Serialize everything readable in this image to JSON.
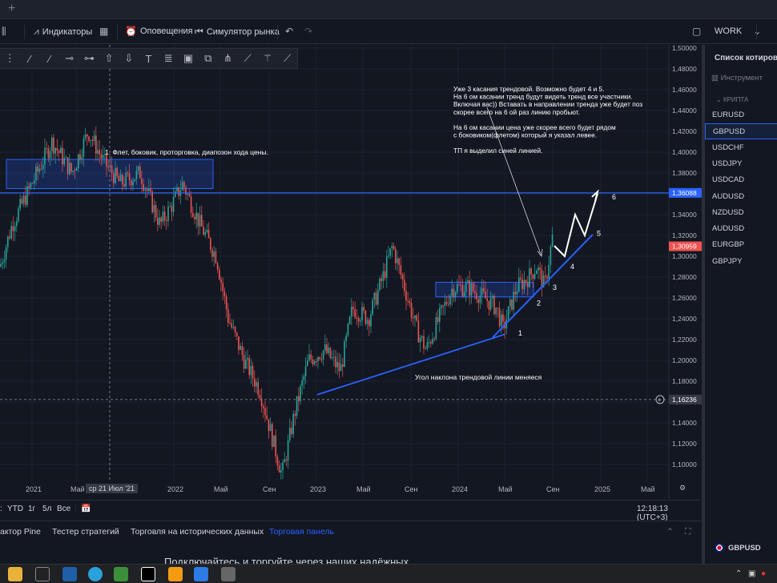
{
  "toolbar": {
    "indicators_label": "Индикаторы",
    "alerts_label": "Оповещения",
    "replay_label": "Симулятор рынка",
    "layout_label": "WORK"
  },
  "chart": {
    "price_axis": [
      "1,50000",
      "1,48000",
      "1,46000",
      "1,44000",
      "1,42000",
      "1,40000",
      "1,38000",
      "1,36000",
      "1,34000",
      "1,32000",
      "1,30000",
      "1,28000",
      "1,26000",
      "1,24000",
      "1,22000",
      "1,20000",
      "1,18000",
      "1,16000",
      "1,14000",
      "1,12000",
      "1,10000"
    ],
    "price_labels": {
      "hline": "1,36088",
      "current": "1,30959",
      "crosshair": "1,16236"
    },
    "time_axis": [
      "2021",
      "Май",
      "2022",
      "Май",
      "Сен",
      "2023",
      "Май",
      "Сен",
      "2024",
      "Май",
      "Сен",
      "2025",
      "Май"
    ],
    "crosshair_date": "ср 21 Июл '21",
    "annotations": {
      "flat": "1. Флет, боковик, проторговка, диапозон хода цены.",
      "note_lines": [
        "Уже 3 касания трендовой. Возможно будет 4 и 5.",
        "На 6 ом касании тренд будут видеть тренд все участники.",
        "Включая вас)) Вставать в направлении тренда уже будет поз",
        "скорее всего на 6 ой раз линию пробьют.",
        "",
        "На 6 ом касании цена уже скорее всего будет рядом",
        "с боковиком(флетом) который я указал левее.",
        "",
        "ТП я выделил синей линией."
      ],
      "slope": "Угол наклона трендовой линии меняеся",
      "touches": [
        "1",
        "2",
        "3",
        "4",
        "5",
        "6"
      ]
    }
  },
  "bottombar": {
    "ranges": [
      "YTD",
      "1г",
      "5л",
      "Все"
    ],
    "clock": "12:18:13 (UTC+3)"
  },
  "panel": {
    "tabs": [
      "актор Pine",
      "Тестер стратегий",
      "Торговля на исторических данных",
      "Торговая панель"
    ],
    "active_tab": "Торговая панель",
    "promo": "Подключайтесь и торгуйте через наших надёжных"
  },
  "sidebar": {
    "title": "Список котировок",
    "column_header": "Инструмент",
    "section": "КРИПТА",
    "symbols": [
      "EURUSD",
      "GBPUSD",
      "USDCHF",
      "USDJPY",
      "USDCAD",
      "AUDUSD",
      "NZDUSD",
      "AUDUSD",
      "EURGBP",
      "GBPJPY"
    ],
    "selected": "GBPUSD",
    "footer_symbol": "GBPUSD"
  },
  "colors": {
    "accent": "#2962ff",
    "up": "#26a69a",
    "down": "#ef5350",
    "bg": "#131722"
  }
}
